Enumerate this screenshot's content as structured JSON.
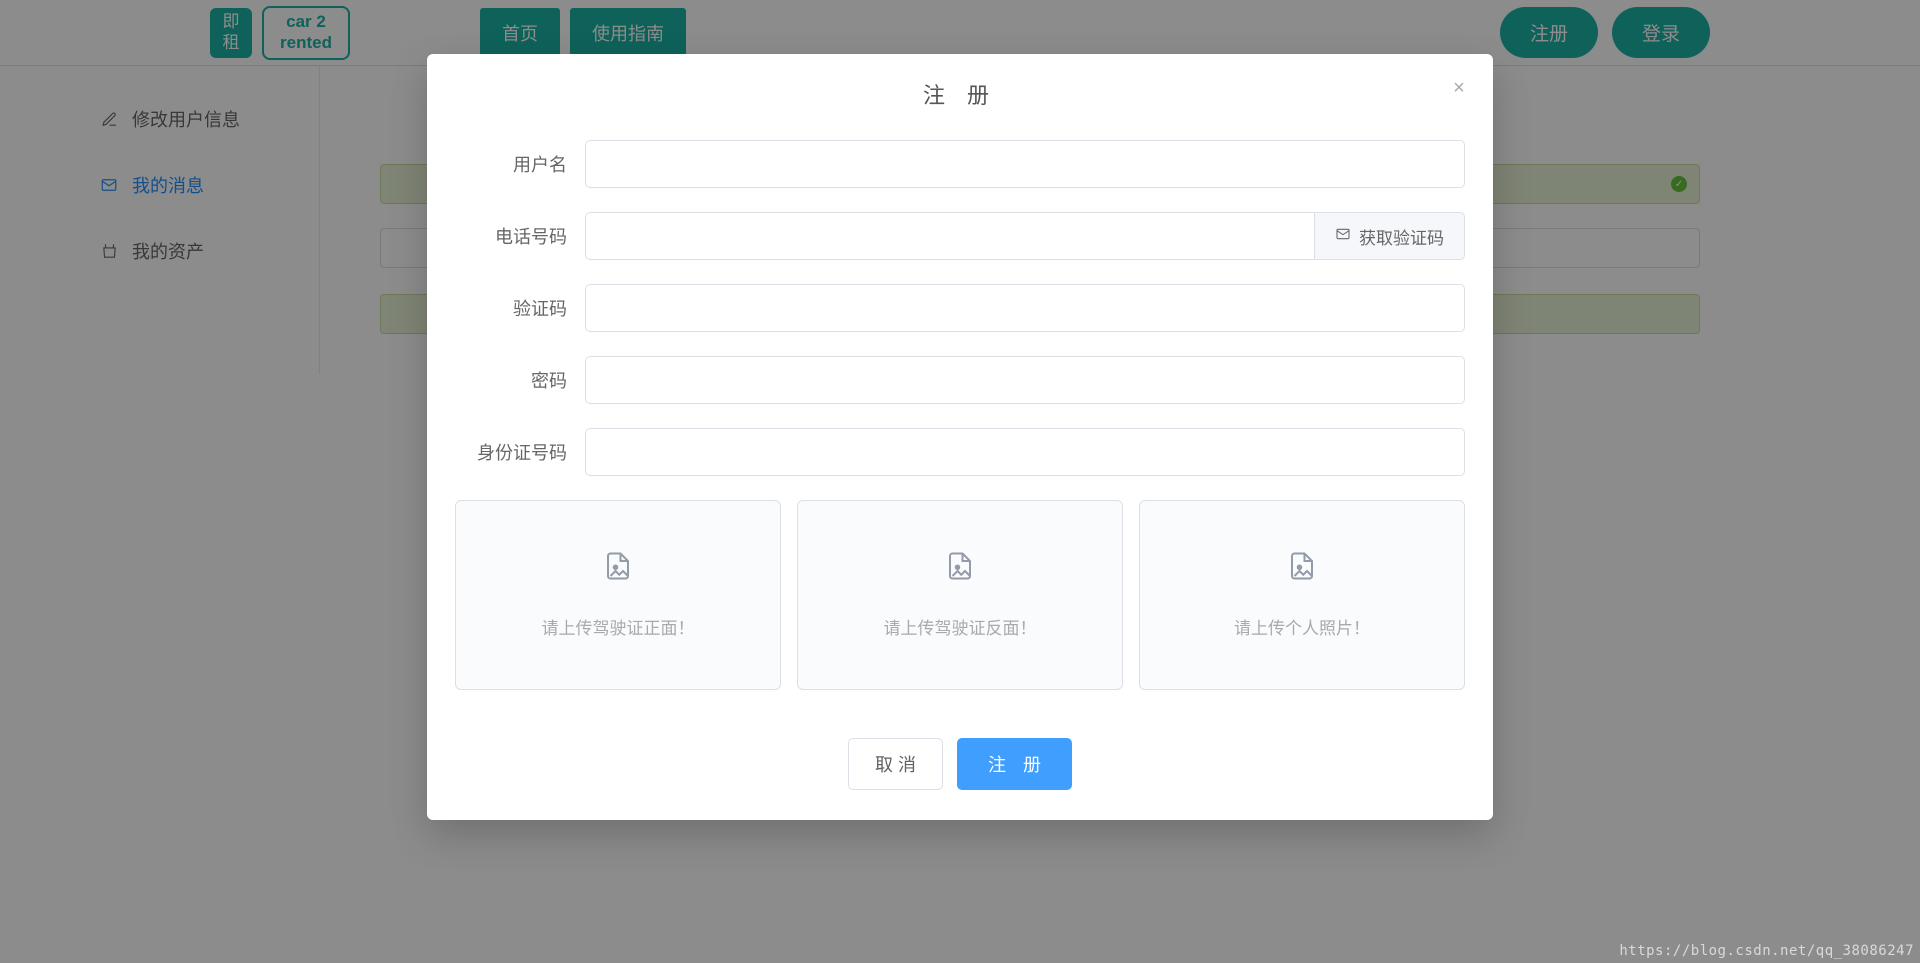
{
  "header": {
    "logo_sq_l1": "即",
    "logo_sq_l2": "租",
    "logo_out_l1": "car  2",
    "logo_out_l2": "rented",
    "nav": [
      "首页",
      "使用指南"
    ],
    "right": {
      "register": "注册",
      "login": "登录"
    }
  },
  "sidebar": {
    "items": [
      {
        "label": "修改用户信息",
        "icon": "edit"
      },
      {
        "label": "我的消息",
        "icon": "mail",
        "active": true
      },
      {
        "label": "我的资产",
        "icon": "wallet"
      }
    ]
  },
  "modal": {
    "title": "注 册",
    "close": "×",
    "fields": {
      "username": "用户名",
      "phone": "电话号码",
      "get_code": "获取验证码",
      "captcha": "验证码",
      "password": "密码",
      "idcard": "身份证号码"
    },
    "uploads": [
      "请上传驾驶证正面！",
      "请上传驾驶证反面！",
      "请上传个人照片！"
    ],
    "footer": {
      "cancel": "取 消",
      "submit": "注 册"
    }
  },
  "watermark": "https://blog.csdn.net/qq_38086247"
}
